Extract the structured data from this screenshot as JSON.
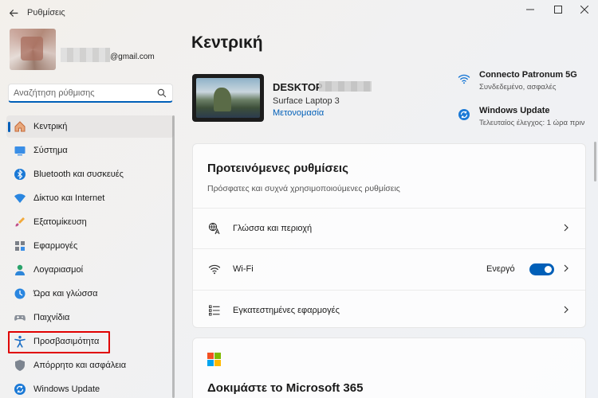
{
  "window": {
    "title": "Ρυθμίσεις",
    "back_icon": "arrow-left-icon",
    "controls": [
      "minimize",
      "maximize",
      "close"
    ]
  },
  "profile": {
    "email": "@gmail.com"
  },
  "search": {
    "placeholder": "Αναζήτηση ρύθμισης",
    "value": ""
  },
  "sidebar": {
    "items": [
      {
        "label": "Κεντρική",
        "icon": "home-icon",
        "active": true
      },
      {
        "label": "Σύστημα",
        "icon": "system-icon",
        "active": false
      },
      {
        "label": "Bluetooth και συσκευές",
        "icon": "bluetooth-icon",
        "active": false
      },
      {
        "label": "Δίκτυο και Internet",
        "icon": "network-icon",
        "active": false
      },
      {
        "label": "Εξατομίκευση",
        "icon": "brush-icon",
        "active": false
      },
      {
        "label": "Εφαρμογές",
        "icon": "apps-icon",
        "active": false
      },
      {
        "label": "Λογαριασμοί",
        "icon": "account-icon",
        "active": false
      },
      {
        "label": "Ώρα και γλώσσα",
        "icon": "clock-globe-icon",
        "active": false
      },
      {
        "label": "Παιχνίδια",
        "icon": "gamepad-icon",
        "active": false
      },
      {
        "label": "Προσβασιμότητα",
        "icon": "accessibility-icon",
        "active": false
      },
      {
        "label": "Απόρρητο και ασφάλεια",
        "icon": "shield-icon",
        "active": false
      },
      {
        "label": "Windows Update",
        "icon": "update-icon",
        "active": false
      }
    ]
  },
  "main": {
    "title": "Κεντρική",
    "device": {
      "name": "DESKTOP",
      "model": "Surface Laptop 3",
      "rename": "Μετονομασία"
    },
    "wifi_status": {
      "title": "Connecto Patronum 5G",
      "subtitle": "Συνδεδεμένο, ασφαλές",
      "icon": "wifi-icon"
    },
    "update_status": {
      "title": "Windows Update",
      "subtitle": "Τελευταίος έλεγχος: 1 ώρα πριν",
      "icon": "update-icon"
    },
    "recommended": {
      "title": "Προτεινόμενες ρυθμίσεις",
      "subtitle": "Πρόσφατες και συχνά χρησιμοποιούμενες ρυθμίσεις",
      "rows": [
        {
          "label": "Γλώσσα και περιοχή",
          "icon": "language-icon"
        },
        {
          "label": "Wi-Fi",
          "icon": "wifi-icon",
          "toggle_label": "Ενεργό",
          "toggle_on": true
        },
        {
          "label": "Εγκατεστημένες εφαρμογές",
          "icon": "list-icon"
        }
      ]
    },
    "m365": {
      "title": "Δοκιμάστε το Microsoft 365",
      "logo_colors": [
        "#f25022",
        "#7fba00",
        "#00a4ef",
        "#ffb900"
      ]
    }
  },
  "colors": {
    "accent": "#005fb8",
    "highlight": "#e00000"
  }
}
